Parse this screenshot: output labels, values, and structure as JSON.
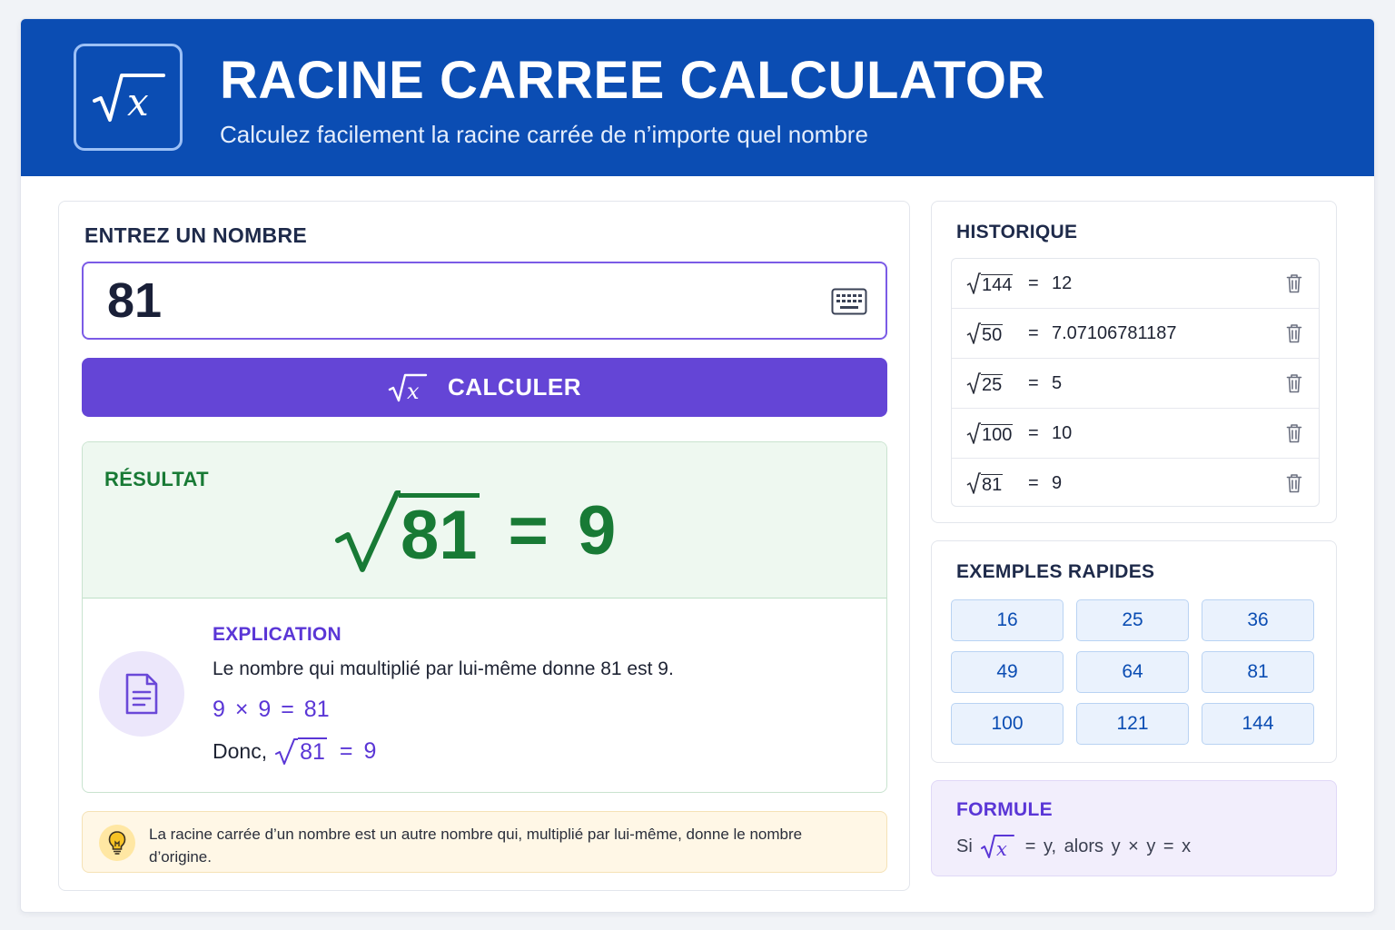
{
  "header": {
    "title": "RACINE CARREE CALCULATOR",
    "subtitle": "Calculez facilement la racine carrée de n’importe quel nombre",
    "logo_icon": "square-root-x-icon"
  },
  "input_section": {
    "label": "ENTREZ UN NOMBRE",
    "value": "81",
    "keyboard_icon": "keyboard-icon"
  },
  "calculate_button": {
    "label": "CALCULER",
    "icon": "square-root-x-icon",
    "color": "#6445d6"
  },
  "result": {
    "label": "RÉSULTAT",
    "radicand": "81",
    "equals": "=",
    "value": "9",
    "color": "#187a35"
  },
  "explanation": {
    "label": "EXPLICATION",
    "text": "Le nombre qui mɑultiplié par lui-même donne 81 est 9.",
    "multiplication": "9 × 9 = 81",
    "donc_prefix": "Donc,",
    "donc_radicand": "81",
    "donc_equals": "=",
    "donc_value": "9",
    "icon": "document-icon"
  },
  "tip": {
    "icon": "lightbulb-icon",
    "text": "La racine carrée d’un nombre est un autre nombre qui, multiplié par lui-même, donne le nombre d’origine."
  },
  "history": {
    "label": "HISTORIQUE",
    "items": [
      {
        "radicand": "144",
        "equals": "=",
        "value": "12"
      },
      {
        "radicand": "50",
        "equals": "=",
        "value": "7.07106781187"
      },
      {
        "radicand": "25",
        "equals": "=",
        "value": "5"
      },
      {
        "radicand": "100",
        "equals": "=",
        "value": "10"
      },
      {
        "radicand": "81",
        "equals": "=",
        "value": "9"
      }
    ],
    "delete_icon": "trash-icon"
  },
  "examples": {
    "label": "EXEMPLES RAPIDES",
    "items": [
      "16",
      "25",
      "36",
      "49",
      "64",
      "81",
      "100",
      "121",
      "144"
    ]
  },
  "formula": {
    "label": "FORMULE",
    "prefix": "Si",
    "rest": "= y, alors  y × y = x"
  },
  "colors": {
    "header_bg": "#0b4db3",
    "accent_purple": "#5a36d6",
    "result_green": "#187a35"
  }
}
